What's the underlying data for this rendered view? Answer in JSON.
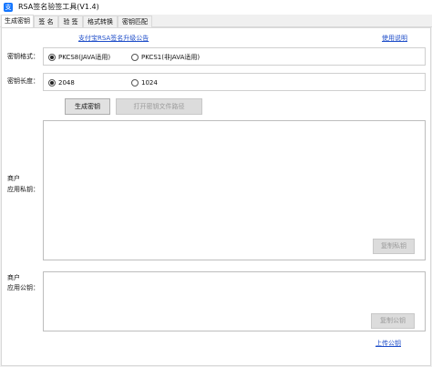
{
  "window": {
    "title": "RSA签名验签工具(V1.4)",
    "icon": "alipay-icon"
  },
  "tabs": [
    {
      "label": "生成密钥",
      "active": true
    },
    {
      "label": "签 名",
      "active": false
    },
    {
      "label": "验 签",
      "active": false
    },
    {
      "label": "格式转换",
      "active": false
    },
    {
      "label": "密钥匹配",
      "active": false
    }
  ],
  "links": {
    "announcement": "支付宝RSA签名升级公告",
    "help": "使用说明",
    "upload_public_key": "上传公钥"
  },
  "key_format": {
    "label": "密钥格式：",
    "options": [
      "PKCS8(JAVA适用)",
      "PKCS1(非JAVA适用)"
    ],
    "selected": "PKCS8(JAVA适用)"
  },
  "key_length": {
    "label": "密钥长度：",
    "options": [
      "2048",
      "1024"
    ],
    "selected": "2048"
  },
  "buttons": {
    "generate": "生成密钥",
    "open_path": "打开密钥文件路径",
    "copy_private": "复制私钥",
    "copy_public": "复制公钥"
  },
  "private_key": {
    "label_line1": "商户",
    "label_line2": "应用私钥：",
    "value": ""
  },
  "public_key": {
    "label_line1": "商户",
    "label_line2": "应用公钥：",
    "value": ""
  },
  "colors": {
    "link": "#1f4ec9",
    "icon": "#1677ff"
  }
}
